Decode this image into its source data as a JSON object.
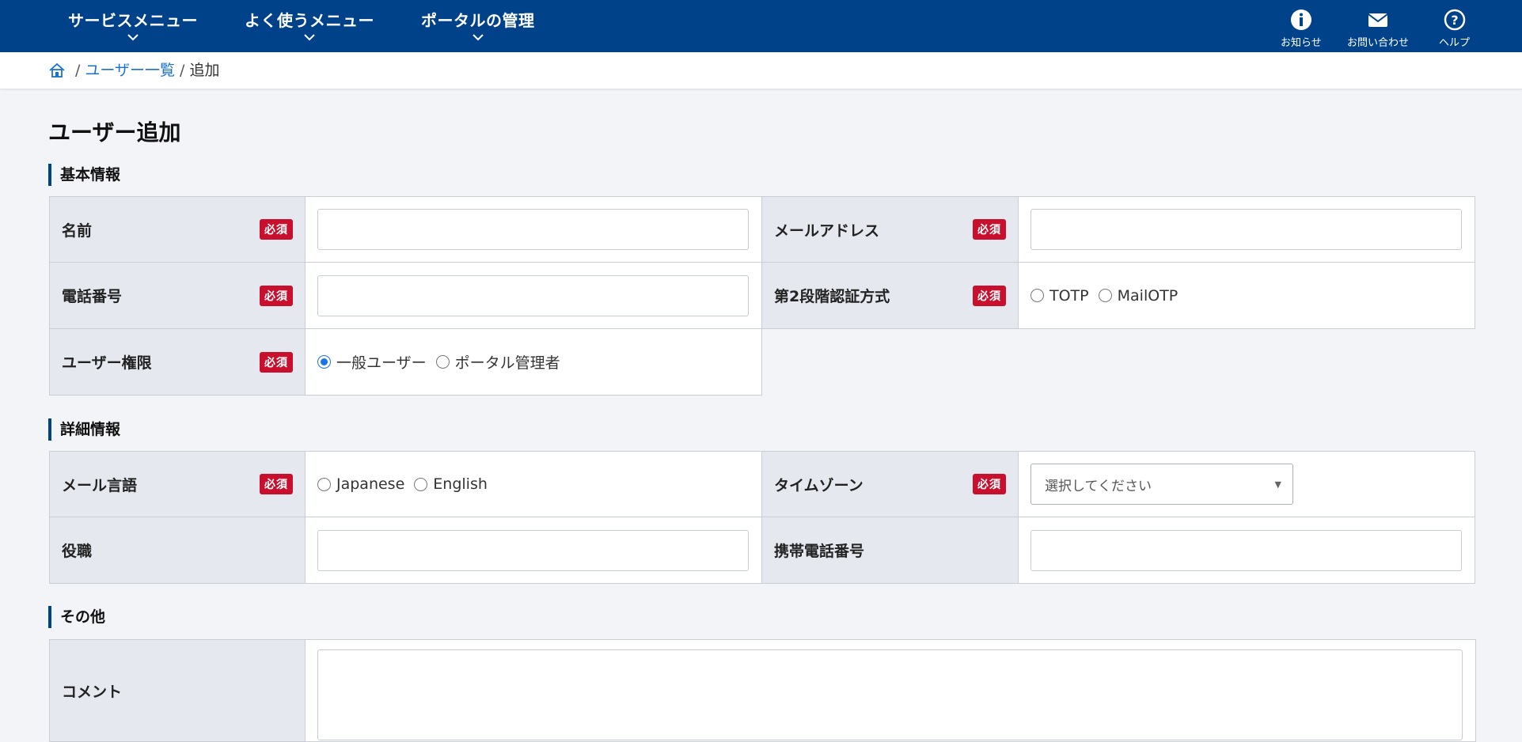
{
  "nav": {
    "menus": [
      "サービスメニュー",
      "よく使うメニュー",
      "ポータルの管理"
    ],
    "tools": {
      "info": "お知らせ",
      "contact": "お問い合わせ",
      "help": "ヘルプ"
    }
  },
  "breadcrumb": {
    "list": "ユーザー一覧",
    "current": "追加",
    "separator": "/"
  },
  "page": {
    "title": "ユーザー追加"
  },
  "sections": {
    "basic": "基本情報",
    "detail": "詳細情報",
    "other": "その他"
  },
  "required_badge": "必須",
  "fields": {
    "name": "名前",
    "email": "メールアドレス",
    "phone": "電話番号",
    "mfa": "第2段階認証方式",
    "mfa_options": [
      "TOTP",
      "MailOTP"
    ],
    "role": "ユーザー権限",
    "role_options": [
      "一般ユーザー",
      "ポータル管理者"
    ],
    "role_selected": "一般ユーザー",
    "mail_lang": "メール言語",
    "mail_lang_options": [
      "Japanese",
      "English"
    ],
    "timezone": "タイムゾーン",
    "timezone_placeholder": "選択してください",
    "position": "役職",
    "mobile": "携帯電話番号",
    "comment": "コメント"
  },
  "colors": {
    "nav_bg": "#004289",
    "required": "#c8102e",
    "link": "#1a73c8",
    "accent": "#004289"
  }
}
